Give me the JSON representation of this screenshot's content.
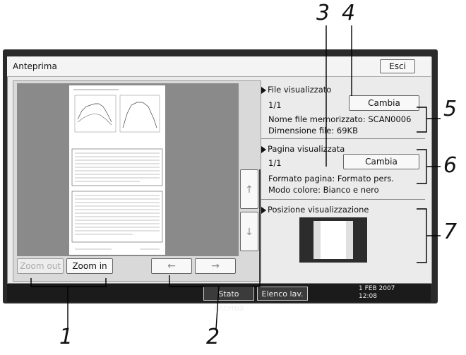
{
  "window": {
    "title": "Anteprima",
    "exit_label": "Esci"
  },
  "preview": {
    "zoom_out_label": "Zoom out",
    "zoom_in_label": "Zoom in",
    "arrow_up": "↑",
    "arrow_down": "↓",
    "arrow_left": "←",
    "arrow_right": "→"
  },
  "file_section": {
    "header": "File visualizzato",
    "counter": "1/1",
    "change_label": "Cambia",
    "name_line": "Nome file memorizzato: SCAN0006",
    "size_line": "Dimensione file: 69KB"
  },
  "page_section": {
    "header": "Pagina visualizzata",
    "counter": "1/1",
    "change_label": "Cambia",
    "format_line": "Formato pagina: Formato pers.",
    "color_line": "Modo colore: Bianco e nero"
  },
  "position_section": {
    "header": "Posizione visualizzazione"
  },
  "status_bar": {
    "system_status_label": "Stato sistema",
    "job_list_label": "Elenco lav.",
    "date": "1 FEB  2007",
    "time": "12:08"
  },
  "callouts": [
    "1",
    "2",
    "3",
    "4",
    "5",
    "6",
    "7"
  ]
}
